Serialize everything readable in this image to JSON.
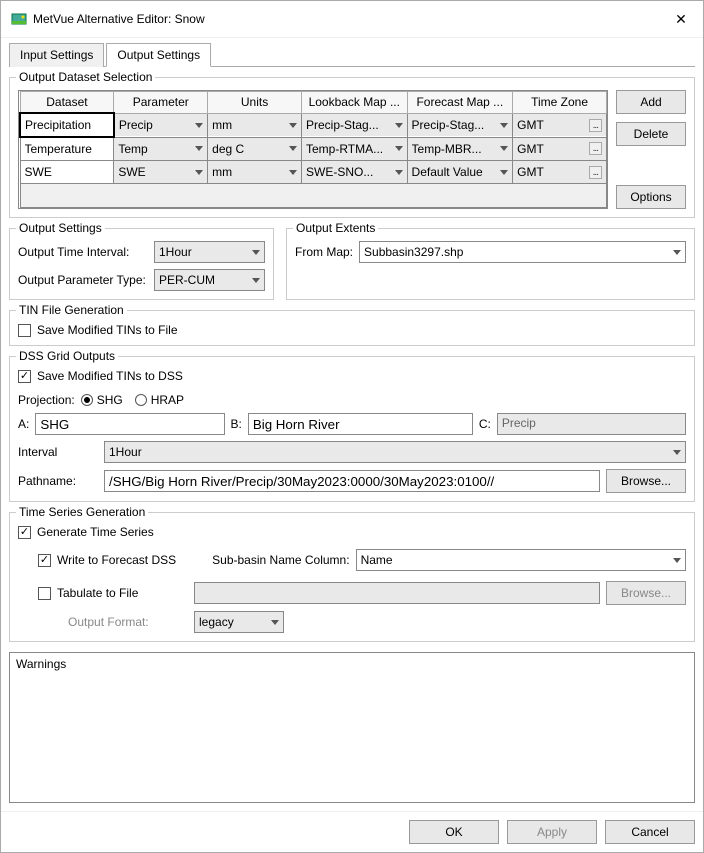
{
  "window": {
    "title": "MetVue Alternative Editor: Snow"
  },
  "tabs": {
    "input": "Input Settings",
    "output": "Output Settings"
  },
  "datasetSelection": {
    "legend": "Output Dataset Selection",
    "headers": {
      "dataset": "Dataset",
      "parameter": "Parameter",
      "units": "Units",
      "lookback": "Lookback Map ...",
      "forecast": "Forecast Map ...",
      "timezone": "Time Zone"
    },
    "rows": [
      {
        "dataset": "Precipitation",
        "parameter": "Precip",
        "units": "mm",
        "lookback": "Precip-Stag...",
        "forecast": "Precip-Stag...",
        "timezone": "GMT"
      },
      {
        "dataset": "Temperature",
        "parameter": "Temp",
        "units": "deg C",
        "lookback": "Temp-RTMA...",
        "forecast": "Temp-MBR...",
        "timezone": "GMT"
      },
      {
        "dataset": "SWE",
        "parameter": "SWE",
        "units": "mm",
        "lookback": "SWE-SNO...",
        "forecast": "Default Value",
        "timezone": "GMT"
      }
    ],
    "buttons": {
      "add": "Add",
      "delete": "Delete",
      "options": "Options"
    }
  },
  "outputSettings": {
    "legend": "Output Settings",
    "intervalLabel": "Output Time Interval:",
    "intervalValue": "1Hour",
    "paramTypeLabel": "Output Parameter Type:",
    "paramTypeValue": "PER-CUM"
  },
  "outputExtents": {
    "legend": "Output Extents",
    "fromMapLabel": "From Map:",
    "fromMapValue": "Subbasin3297.shp"
  },
  "tinGen": {
    "legend": "TIN File Generation",
    "saveToFile": "Save Modified TINs to File"
  },
  "dssGrid": {
    "legend": "DSS Grid Outputs",
    "saveToDss": "Save Modified TINs to DSS",
    "projectionLabel": "Projection:",
    "shg": "SHG",
    "hrap": "HRAP",
    "aLabel": "A:",
    "aValue": "SHG",
    "bLabel": "B:",
    "bValue": "Big Horn River",
    "cLabel": "C:",
    "cValue": "Precip",
    "intervalLabel": "Interval",
    "intervalValue": "1Hour",
    "pathnameLabel": "Pathname:",
    "pathnameValue": "/SHG/Big Horn River/Precip/30May2023:0000/30May2023:0100//",
    "browse": "Browse..."
  },
  "tsGen": {
    "legend": "Time Series Generation",
    "generate": "Generate Time Series",
    "writeDss": "Write to Forecast DSS",
    "subbasinLabel": "Sub-basin Name Column:",
    "subbasinValue": "Name",
    "tabulate": "Tabulate to File",
    "browse": "Browse...",
    "outputFormatLabel": "Output Format:",
    "outputFormatValue": "legacy"
  },
  "warningsLabel": "Warnings",
  "buttons": {
    "ok": "OK",
    "apply": "Apply",
    "cancel": "Cancel"
  }
}
